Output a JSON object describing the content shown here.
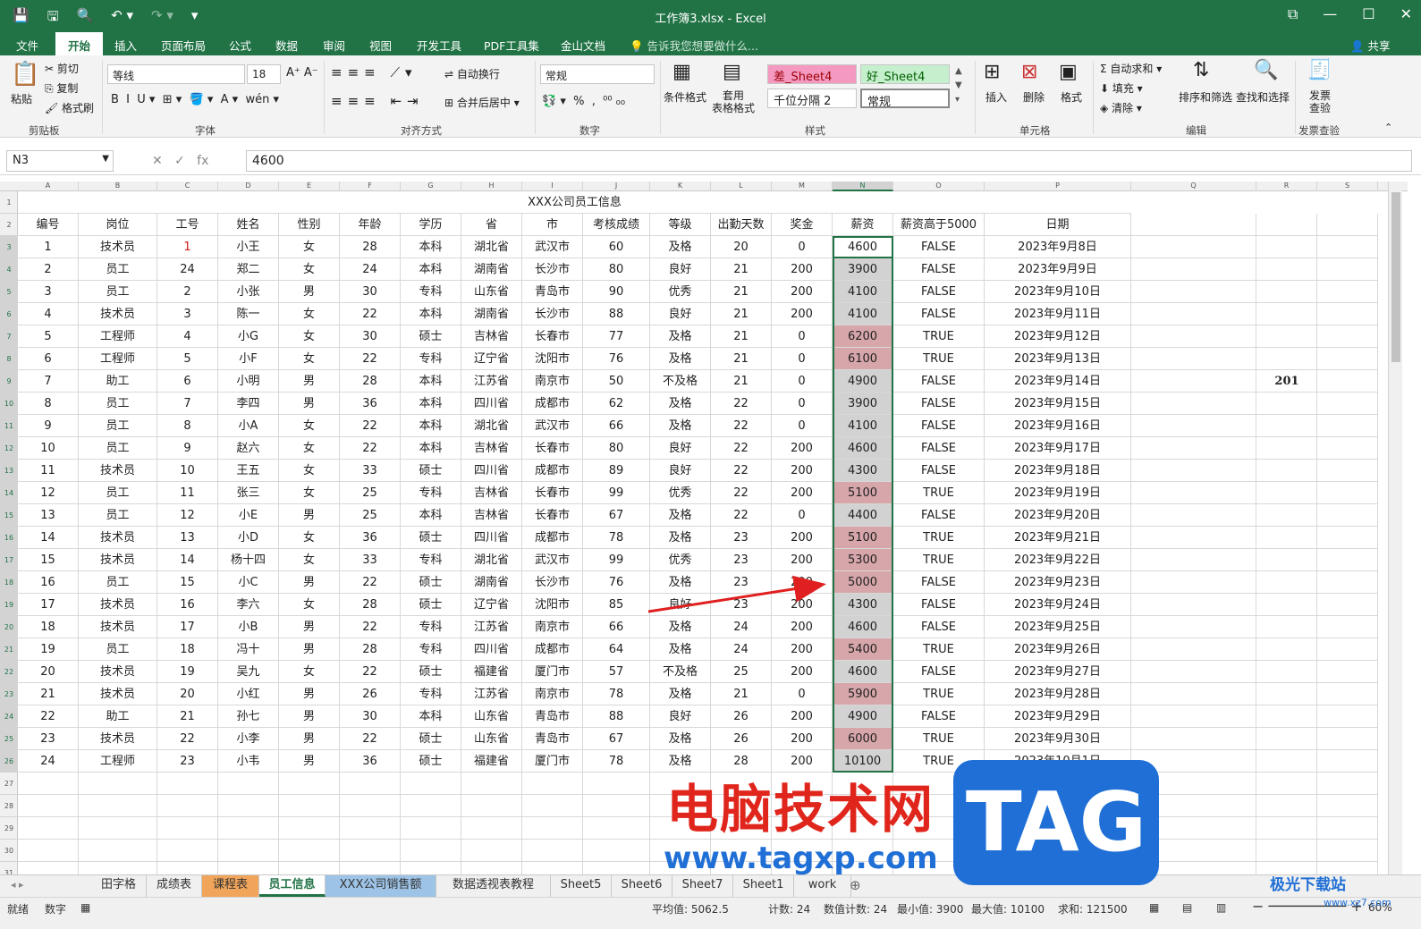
{
  "titlebar": {
    "title": "工作簿3.xlsx - Excel",
    "qat": [
      "💾",
      "🖫",
      "🔍",
      "↶ ▾",
      "↷ ▾",
      "▾"
    ],
    "win": [
      "⧉",
      "—",
      "☐",
      "✕"
    ]
  },
  "menu": [
    "文件",
    "开始",
    "插入",
    "页面布局",
    "公式",
    "数据",
    "审阅",
    "视图",
    "开发工具",
    "PDF工具集",
    "金山文档",
    "💡 告诉我您想要做什么...",
    "👤 共享"
  ],
  "ribbon": {
    "paste": "粘贴",
    "cut": "✂ 剪切",
    "copy": "⎘ 复制",
    "painter": "🖌 格式刷",
    "clipboard": "剪贴板",
    "font_name": "等线",
    "font_size": "18",
    "font_group": "字体",
    "font_btns": "B  I  U ▾  ⊞ ▾  🪣 ▾  A ▾  wén ▾",
    "grow": "A⁺ A⁻",
    "wrap": "自动换行",
    "merge": "合并后居中 ▾",
    "align_group": "对齐方式",
    "numfmt": "常规",
    "num_group": "数字",
    "num_btns": "💱 ▾  %  ,  ⁰⁰ ₀₀",
    "cond": "条件格式",
    "table": "套用\n表格格式",
    "style_bad": "差_Sheet4",
    "style_good": "好_Sheet4",
    "style_sep": "千位分隔 2",
    "style_normal": "常规",
    "style_group": "样式",
    "insert": "插入",
    "delete": "删除",
    "format": "格式",
    "cells_group": "单元格",
    "autosum": "Σ 自动求和 ▾",
    "fill": "⬇ 填充 ▾",
    "clear": "◈ 清除 ▾",
    "sortfilter": "排序和筛选",
    "findselect": "查找和选择",
    "edit_group": "编辑",
    "invoice": "发票\n查验",
    "invoice_group": "发票查验"
  },
  "formula": {
    "namebox": "N3",
    "value": "4600",
    "icons": "✕   ✓   fx"
  },
  "columns": [
    "A",
    "B",
    "C",
    "D",
    "E",
    "F",
    "G",
    "H",
    "I",
    "J",
    "K",
    "L",
    "M",
    "N",
    "O",
    "P",
    "Q",
    "R",
    "S"
  ],
  "sheet_title": "XXX公司员工信息",
  "headers": [
    "编号",
    "岗位",
    "工号",
    "姓名",
    "性别",
    "年龄",
    "学历",
    "省",
    "市",
    "考核成绩",
    "等级",
    "出勤天数",
    "奖金",
    "薪资",
    "薪资高于5000",
    "日期"
  ],
  "rows": [
    [
      "1",
      "技术员",
      "1",
      "小王",
      "女",
      "28",
      "本科",
      "湖北省",
      "武汉市",
      "60",
      "及格",
      "20",
      "0",
      "4600",
      "FALSE",
      "2023年9月8日"
    ],
    [
      "2",
      "员工",
      "24",
      "郑二",
      "女",
      "24",
      "本科",
      "湖南省",
      "长沙市",
      "80",
      "良好",
      "21",
      "200",
      "3900",
      "FALSE",
      "2023年9月9日"
    ],
    [
      "3",
      "员工",
      "2",
      "小张",
      "男",
      "30",
      "专科",
      "山东省",
      "青岛市",
      "90",
      "优秀",
      "21",
      "200",
      "4100",
      "FALSE",
      "2023年9月10日"
    ],
    [
      "4",
      "技术员",
      "3",
      "陈一",
      "女",
      "22",
      "本科",
      "湖南省",
      "长沙市",
      "88",
      "良好",
      "21",
      "200",
      "4100",
      "FALSE",
      "2023年9月11日"
    ],
    [
      "5",
      "工程师",
      "4",
      "小G",
      "女",
      "30",
      "硕士",
      "吉林省",
      "长春市",
      "77",
      "及格",
      "21",
      "0",
      "6200",
      "TRUE",
      "2023年9月12日"
    ],
    [
      "6",
      "工程师",
      "5",
      "小F",
      "女",
      "22",
      "专科",
      "辽宁省",
      "沈阳市",
      "76",
      "及格",
      "21",
      "0",
      "6100",
      "TRUE",
      "2023年9月13日"
    ],
    [
      "7",
      "助工",
      "6",
      "小明",
      "男",
      "28",
      "本科",
      "江苏省",
      "南京市",
      "50",
      "不及格",
      "21",
      "0",
      "4900",
      "FALSE",
      "2023年9月14日"
    ],
    [
      "8",
      "员工",
      "7",
      "李四",
      "男",
      "36",
      "本科",
      "四川省",
      "成都市",
      "62",
      "及格",
      "22",
      "0",
      "3900",
      "FALSE",
      "2023年9月15日"
    ],
    [
      "9",
      "员工",
      "8",
      "小A",
      "女",
      "22",
      "本科",
      "湖北省",
      "武汉市",
      "66",
      "及格",
      "22",
      "0",
      "4100",
      "FALSE",
      "2023年9月16日"
    ],
    [
      "10",
      "员工",
      "9",
      "赵六",
      "女",
      "22",
      "本科",
      "吉林省",
      "长春市",
      "80",
      "良好",
      "22",
      "200",
      "4600",
      "FALSE",
      "2023年9月17日"
    ],
    [
      "11",
      "技术员",
      "10",
      "王五",
      "女",
      "33",
      "硕士",
      "四川省",
      "成都市",
      "89",
      "良好",
      "22",
      "200",
      "4300",
      "FALSE",
      "2023年9月18日"
    ],
    [
      "12",
      "员工",
      "11",
      "张三",
      "女",
      "25",
      "专科",
      "吉林省",
      "长春市",
      "99",
      "优秀",
      "22",
      "200",
      "5100",
      "TRUE",
      "2023年9月19日"
    ],
    [
      "13",
      "员工",
      "12",
      "小E",
      "男",
      "25",
      "本科",
      "吉林省",
      "长春市",
      "67",
      "及格",
      "22",
      "0",
      "4400",
      "FALSE",
      "2023年9月20日"
    ],
    [
      "14",
      "技术员",
      "13",
      "小D",
      "女",
      "36",
      "硕士",
      "四川省",
      "成都市",
      "78",
      "及格",
      "23",
      "200",
      "5100",
      "TRUE",
      "2023年9月21日"
    ],
    [
      "15",
      "技术员",
      "14",
      "杨十四",
      "女",
      "33",
      "专科",
      "湖北省",
      "武汉市",
      "99",
      "优秀",
      "23",
      "200",
      "5300",
      "TRUE",
      "2023年9月22日"
    ],
    [
      "16",
      "员工",
      "15",
      "小C",
      "男",
      "22",
      "硕士",
      "湖南省",
      "长沙市",
      "76",
      "及格",
      "23",
      "200",
      "5000",
      "FALSE",
      "2023年9月23日"
    ],
    [
      "17",
      "技术员",
      "16",
      "李六",
      "女",
      "28",
      "硕士",
      "辽宁省",
      "沈阳市",
      "85",
      "良好",
      "23",
      "200",
      "4300",
      "FALSE",
      "2023年9月24日"
    ],
    [
      "18",
      "技术员",
      "17",
      "小B",
      "男",
      "22",
      "专科",
      "江苏省",
      "南京市",
      "66",
      "及格",
      "24",
      "200",
      "4600",
      "FALSE",
      "2023年9月25日"
    ],
    [
      "19",
      "员工",
      "18",
      "冯十",
      "男",
      "28",
      "专科",
      "四川省",
      "成都市",
      "64",
      "及格",
      "24",
      "200",
      "5400",
      "TRUE",
      "2023年9月26日"
    ],
    [
      "20",
      "技术员",
      "19",
      "吴九",
      "女",
      "22",
      "硕士",
      "福建省",
      "厦门市",
      "57",
      "不及格",
      "25",
      "200",
      "4600",
      "FALSE",
      "2023年9月27日"
    ],
    [
      "21",
      "技术员",
      "20",
      "小红",
      "男",
      "26",
      "专科",
      "江苏省",
      "南京市",
      "78",
      "及格",
      "21",
      "0",
      "5900",
      "TRUE",
      "2023年9月28日"
    ],
    [
      "22",
      "助工",
      "21",
      "孙七",
      "男",
      "30",
      "本科",
      "山东省",
      "青岛市",
      "88",
      "良好",
      "26",
      "200",
      "4900",
      "FALSE",
      "2023年9月29日"
    ],
    [
      "23",
      "技术员",
      "22",
      "小李",
      "男",
      "22",
      "硕士",
      "山东省",
      "青岛市",
      "67",
      "及格",
      "26",
      "200",
      "6000",
      "TRUE",
      "2023年9月30日"
    ],
    [
      "24",
      "工程师",
      "23",
      "小韦",
      "男",
      "36",
      "硕士",
      "福建省",
      "厦门市",
      "78",
      "及格",
      "28",
      "200",
      "10100",
      "TRUE",
      "2023年10月1日"
    ]
  ],
  "r9_value": "201",
  "tabs": [
    "田字格",
    "成绩表",
    "课程表",
    "员工信息",
    "XXX公司销售额",
    "数据透视表教程",
    "Sheet5",
    "Sheet6",
    "Sheet7",
    "Sheet1",
    "work"
  ],
  "status": {
    "ready": "就绪",
    "numlock": "数字",
    "avg": "平均值: 5062.5",
    "count": "计数: 24",
    "numcount": "数值计数: 24",
    "min": "最小值: 3900",
    "max": "最大值: 10100",
    "sum": "求和: 121500",
    "zoom": "60%"
  },
  "watermark": {
    "cn": "电脑技术网",
    "tag": "TAG",
    "url": "www.tagxp.com",
    "site2": "极光下载站",
    "site2url": "www.xz7.com"
  },
  "colors": {
    "accent": "#217346",
    "highlight": "#d7a6aa",
    "salary_fill": "#d2d2d2"
  }
}
